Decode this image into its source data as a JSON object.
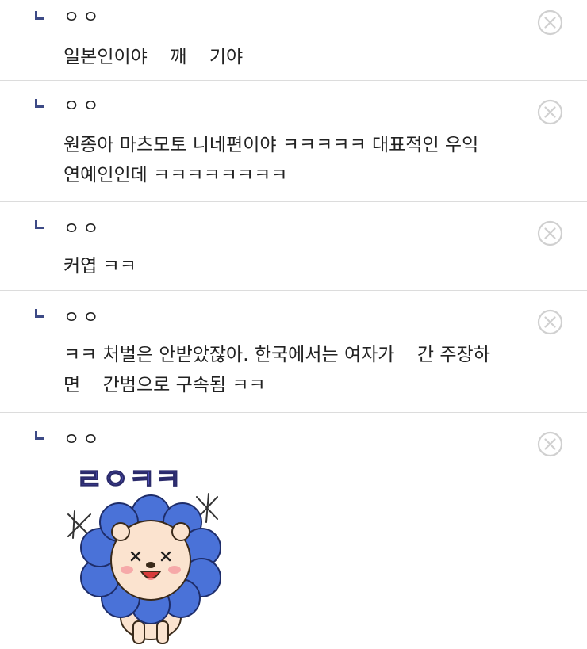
{
  "replies": [
    {
      "nick": "ㅇㅇ",
      "text": "일본인이야 ᅟᅠ깨ᅟ 기야"
    },
    {
      "nick": "ㅇㅇ",
      "text": "원종아 마츠모토 니네편이야 ㅋㅋㅋㅋㅋ 대표적인 우익\n연예인인데 ㅋㅋㅋㅋㅋㅋㅋㅋ"
    },
    {
      "nick": "ㅇㅇ",
      "text": "커엽 ㅋㅋ"
    },
    {
      "nick": "ㅇㅇ",
      "text": "ㅋㅋ 처벌은 안받았잖아. 한국에서는 여자가 ᅟ간 주장하\n면 ᅟ간범으로 구속됨 ㅋㅋ"
    },
    {
      "nick": "ㅇㅇ",
      "text": ""
    }
  ],
  "sticker": {
    "caption": "ㄹㅇㅋㅋ",
    "colors": {
      "petals": "#4a72d8",
      "face": "#fbe3cf",
      "text": "#5a5ad0"
    }
  },
  "icons": {
    "reply": "reply-arrow-icon",
    "delete": "close-circle-icon"
  }
}
